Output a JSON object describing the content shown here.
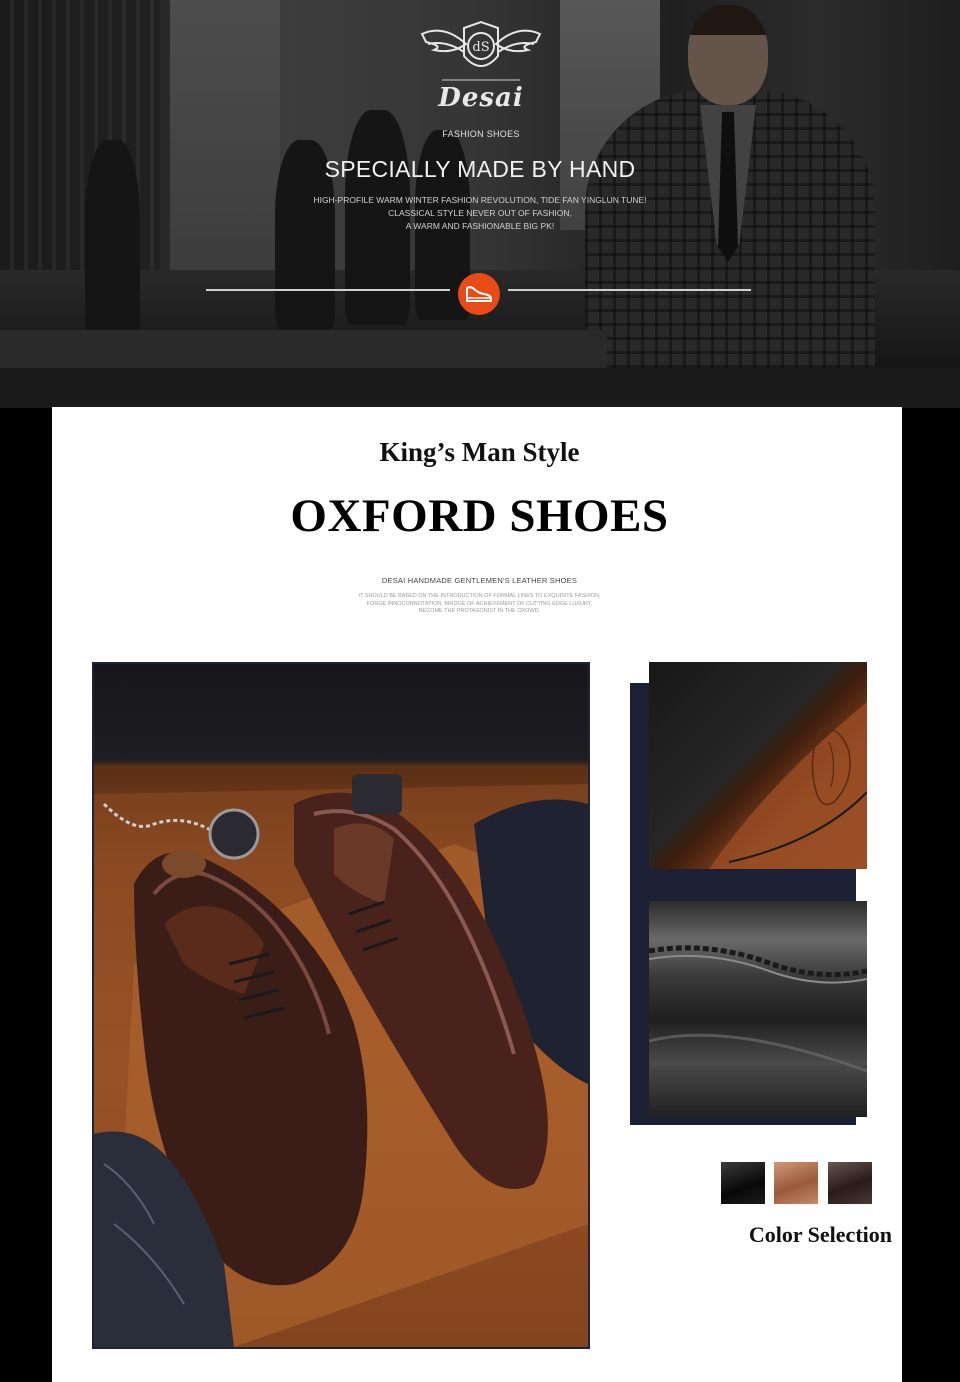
{
  "hero": {
    "brand": "Desai",
    "brand_sub": "FASHION SHOES",
    "title": "SPECIALLY MADE BY HAND",
    "desc_lines": [
      "HIGH-PROFILE WARM WINTER FASHION REVOLUTION, TIDE FAN YINGLUN TUNE!",
      "CLASSICAL STYLE NEVER OUT OF FASHION,",
      "A WARM AND FASHIONABLE BIG PK!"
    ],
    "badge_icon": "shoe-icon",
    "accent_color": "#e84b16"
  },
  "section": {
    "kicker": "King’s Man Style",
    "headline": "OXFORD SHOES",
    "subtitle": "DESAI HANDMADE GENTLEMEN'S LEATHER SHOES",
    "desc_lines": [
      "IT SHOULD BE BASED ON THE INTRODUCTION OF FORMAL LINES TO EXQUISITE FASHION,",
      "FORGE INNOCONNOTATION, BRIDGE OF ACHIEVEMENT OF CUTTING EDGE LUXURY,",
      "BECOME THE PROTAGONIST IN THE CROWD."
    ]
  },
  "colors": {
    "label": "Color Selection",
    "options": [
      {
        "name": "black",
        "hex": "#141414"
      },
      {
        "name": "brown",
        "hex": "#b8724e"
      },
      {
        "name": "dark brown",
        "hex": "#3a2826"
      }
    ]
  }
}
